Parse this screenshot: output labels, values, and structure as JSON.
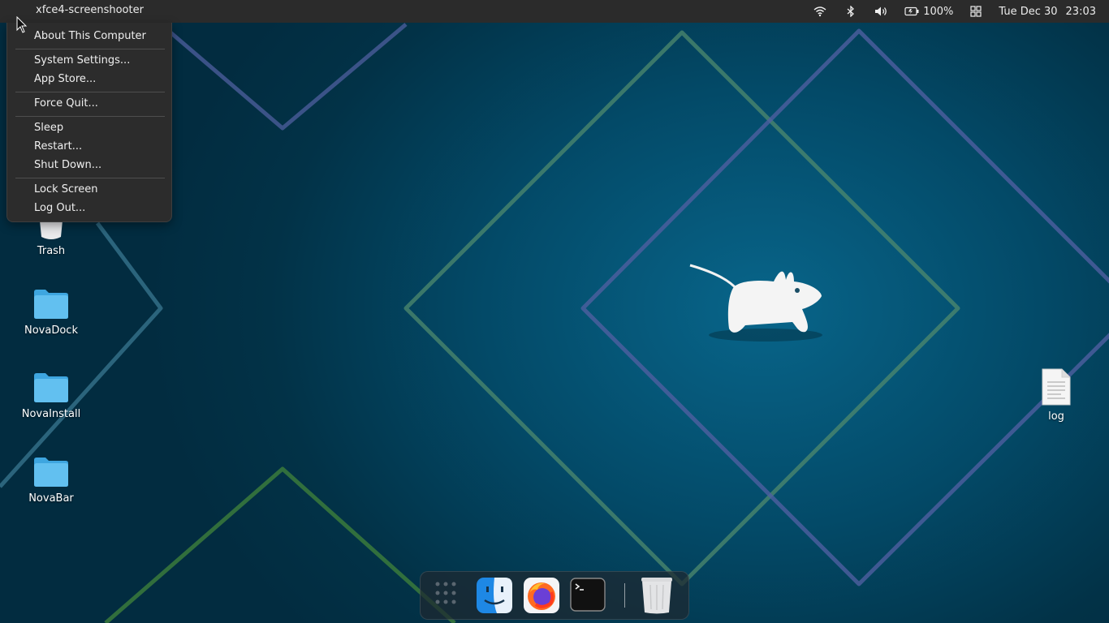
{
  "panel": {
    "title": "xfce4-screenshooter",
    "battery": "100%",
    "clock_day": "Tue Dec 30",
    "clock_time": "23:03"
  },
  "menu": {
    "items": [
      "About This Computer",
      "System Settings...",
      "App Store...",
      "Force Quit...",
      "Sleep",
      "Restart...",
      "Shut Down...",
      "Lock Screen",
      "Log Out..."
    ]
  },
  "desktop": {
    "icons": [
      {
        "label": "Trash"
      },
      {
        "label": "NovaDock"
      },
      {
        "label": "NovaInstall"
      },
      {
        "label": "NovaBar"
      },
      {
        "label": "log"
      }
    ]
  },
  "dock": {
    "items": [
      "app-grid-icon",
      "finder-icon",
      "firefox-icon",
      "terminal-icon",
      "trash-icon"
    ]
  },
  "colors": {
    "panel_bg": "#2b2b2b",
    "menu_bg": "#2c2c2c",
    "folder_blue": "#5bbcef"
  }
}
